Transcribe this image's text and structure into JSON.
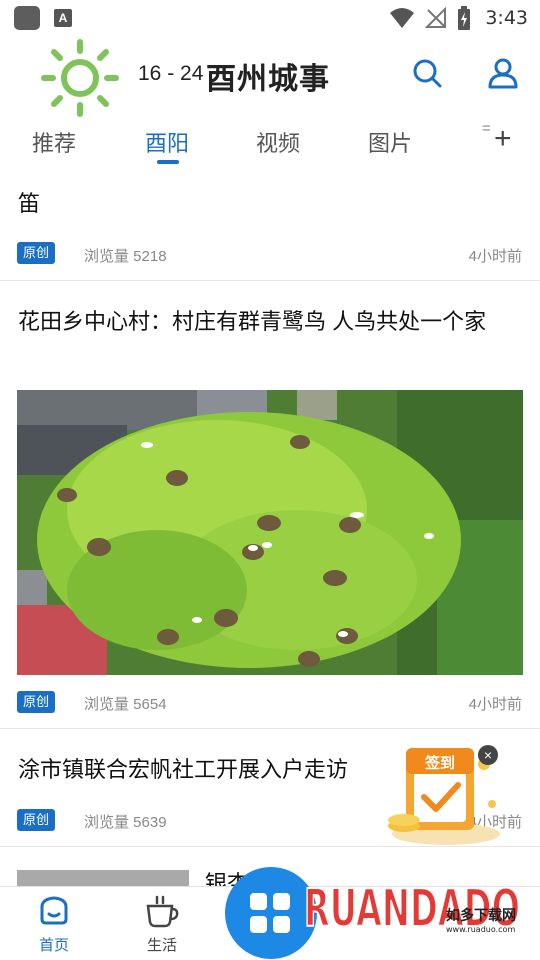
{
  "status_bar": {
    "time": "3:43",
    "icons": [
      "app-icon",
      "a-notification-icon",
      "wifi-icon",
      "no-signal-icon",
      "battery-charging-icon"
    ],
    "badge_letter": "A"
  },
  "header": {
    "weather_icon": "sun-icon",
    "temperature": "16 - 24",
    "title": "酉州城事",
    "search_icon": "search-icon",
    "user_icon": "user-icon",
    "brand_color": "#1a6fc4"
  },
  "tabs": {
    "items": [
      {
        "label": "推荐",
        "active": false
      },
      {
        "label": "酉阳",
        "active": true
      },
      {
        "label": "视频",
        "active": false
      },
      {
        "label": "图片",
        "active": false
      }
    ],
    "overflow": "=",
    "add_icon": "plus-icon",
    "add_label": "+"
  },
  "feed": [
    {
      "title": "笛",
      "badge": "原创",
      "views": "浏览量 5218",
      "time": "4小时前"
    },
    {
      "title": "花田乡中心村：村庄有群青鹭鸟 人鸟共处一个家",
      "image": "aerial-tree-herons-photo",
      "badge": "原创",
      "views": "浏览量 5654",
      "time": "4小时前"
    },
    {
      "title": "涂市镇联合宏帆社工开展入户走访",
      "badge": "原创",
      "views": "浏览量 5639",
      "time": "4小时前"
    },
    {
      "title": "银杏"
    }
  ],
  "signin_popup": {
    "label": "签到",
    "close_label": "×"
  },
  "bottom_nav": {
    "items": [
      {
        "label": "首页",
        "icon": "home-icon",
        "active": true
      },
      {
        "label": "生活",
        "icon": "coffee-cup-icon",
        "active": false
      }
    ]
  },
  "watermark": {
    "brand": "RUANDADO",
    "slogan": "如多下载网",
    "url": "www.ruaduo.com"
  }
}
